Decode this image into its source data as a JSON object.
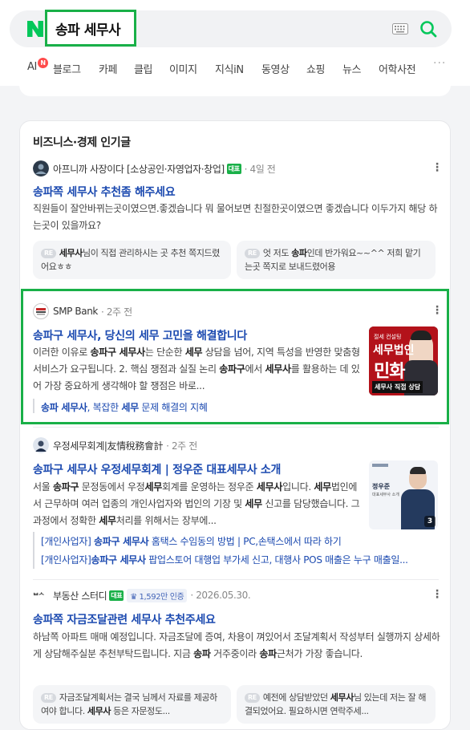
{
  "search": {
    "query": "송파 세무사"
  },
  "tabs": [
    {
      "label": "AI",
      "badge": "N"
    },
    {
      "label": "블로그"
    },
    {
      "label": "카페"
    },
    {
      "label": "클립"
    },
    {
      "label": "이미지"
    },
    {
      "label": "지식iN"
    },
    {
      "label": "동영상"
    },
    {
      "label": "쇼핑"
    },
    {
      "label": "뉴스"
    },
    {
      "label": "어학사전"
    }
  ],
  "more_tabs": "···",
  "section": {
    "title": "비즈니스·경제 인기글"
  },
  "posts": [
    {
      "author": "아프니까 사장이다 [소상공인·자영업자·창업]",
      "badge": "대표",
      "time": "4일 전",
      "title_parts": [
        "송파쪽 ",
        "세무사",
        " 추천좀 해주세요"
      ],
      "desc": "직원들이 잘안바뀌는곳이였으면.좋겠습니다 뭐 물어보면 친절한곳이였으면 좋겠습니다 이두가지 해당 하는곳이 있을까요?",
      "replies": [
        {
          "re": "RE",
          "bold": "세무사",
          "text": "님이 직접 관리하시는 곳 추천 쪽지드렸어요ㅎㅎ"
        },
        {
          "re": "RE",
          "pre": "엇 저도 ",
          "bold": "송파",
          "text": "인데 반가워요~~^^ 저희 맡기는곳 쪽지로 보내드렸어용"
        }
      ]
    },
    {
      "author": "SMP Bank",
      "time": "2주 전",
      "title_parts": [
        "송파구 세무사",
        ", 당신의 ",
        "세무",
        " 고민을 해결합니다"
      ],
      "desc_parts": [
        "이러한 이유로 ",
        "송파구 세무사",
        "는 단순한 ",
        "세무",
        " 상담을 넘어, 지역 특성을 반영한 맞춤형 서비스가 요구됩니다. 2. 핵심 쟁점과 실질 논리 ",
        "송파구",
        "에서 ",
        "세무사",
        "를 활용하는 데 있어 가장 중요하게 생각해야 할 쟁점은 바로..."
      ],
      "thumb": {
        "top": "절세 컨설팅",
        "line1": "세무법인",
        "line2": "민화",
        "bottom": "세무사 직접 상담"
      },
      "sub_link_parts": [
        "송파 세무사",
        ", 복잡한 ",
        "세무",
        " 문제 해결의 지혜"
      ]
    },
    {
      "author": "우정세무회계|友情稅務會計",
      "time": "2주 전",
      "title_parts": [
        "송파구 세무사",
        " 우정",
        "세무",
        "회계 | 정우준 대표",
        "세무사",
        " 소개"
      ],
      "desc_parts": [
        "서울 ",
        "송파구",
        " 문정동에서 우정",
        "세무",
        "회계를 운영하는 정우준 ",
        "세무사",
        "입니다. ",
        "세무",
        "법인에서 근무하며 여러 업종의 개인사업자와 법인의 기장 및 ",
        "세무",
        " 신고를 담당했습니다. 그 과정에서 정확한 ",
        "세무",
        "처리를 위해서는 장부에..."
      ],
      "thumb": {
        "name": "정우준",
        "role": "대표세무사 소개",
        "count": "3"
      },
      "sub_links": [
        [
          "[개인사업자] ",
          "송파구 세무사",
          " 홈택스 수임동의 방법 | PC,손택스에서 따라 하기"
        ],
        [
          "[개인사업자]",
          "송파구 세무사",
          " 팝업스토어 대행업 부가세 신고, 대행사 POS 매출은 누구 매출일..."
        ]
      ]
    },
    {
      "author": "부동산 스터디",
      "badge": "대표",
      "fans": "1,592만 인증",
      "time": "2026.05.30.",
      "title_parts": [
        "송파쪽 자금조달관련 ",
        "세무사",
        " 추천주세요"
      ],
      "desc_parts": [
        "하남쪽 아파트 매매 예정입니다. 자금조달에 증여, 차용이 껴있어서 조달계획서 작성부터 실행까지 상세하게 상담해주실분 추천부탁드립니다. 지금 ",
        "송파",
        " 거주중이라 ",
        "송파",
        "근처가 가장 좋습니다."
      ],
      "replies": [
        {
          "re": "RE",
          "pre": "자금조달계획서는 결국 님께서 자료를 제공하여야 합니다. ",
          "bold": "세무사",
          "text": " 등은 자문정도..."
        },
        {
          "re": "RE",
          "pre": "예전에 상담받았던 ",
          "bold": "세무사",
          "text": "님 있는데 저는 잘 해결되었어요. 필요하시면 연락주세..."
        }
      ]
    }
  ]
}
